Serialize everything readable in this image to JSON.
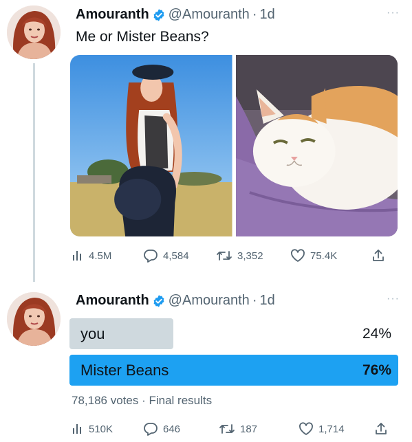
{
  "tweet1": {
    "name": "Amouranth",
    "handle": "@Amouranth",
    "time": "1d",
    "text": "Me or Mister Beans?",
    "stats": {
      "views": "4.5M",
      "replies": "4,584",
      "retweets": "3,352",
      "likes": "75.4K"
    }
  },
  "tweet2": {
    "name": "Amouranth",
    "handle": "@Amouranth",
    "time": "1d",
    "poll": {
      "options": [
        {
          "label": "you",
          "percent": "24%",
          "value": 24
        },
        {
          "label": "Mister Beans",
          "percent": "76%",
          "value": 76
        }
      ],
      "votes": "78,186 votes",
      "status": "Final results"
    },
    "stats": {
      "views": "510K",
      "replies": "646",
      "retweets": "187",
      "likes": "1,714"
    }
  },
  "colors": {
    "verified": "#1d9bf0",
    "poll_winner": "#1da1f2",
    "poll_loser": "#cfd9de",
    "secondary_text": "#536471"
  },
  "icons": [
    "views-icon",
    "reply-icon",
    "retweet-icon",
    "like-icon",
    "share-icon",
    "verified-badge-icon",
    "more-icon"
  ]
}
